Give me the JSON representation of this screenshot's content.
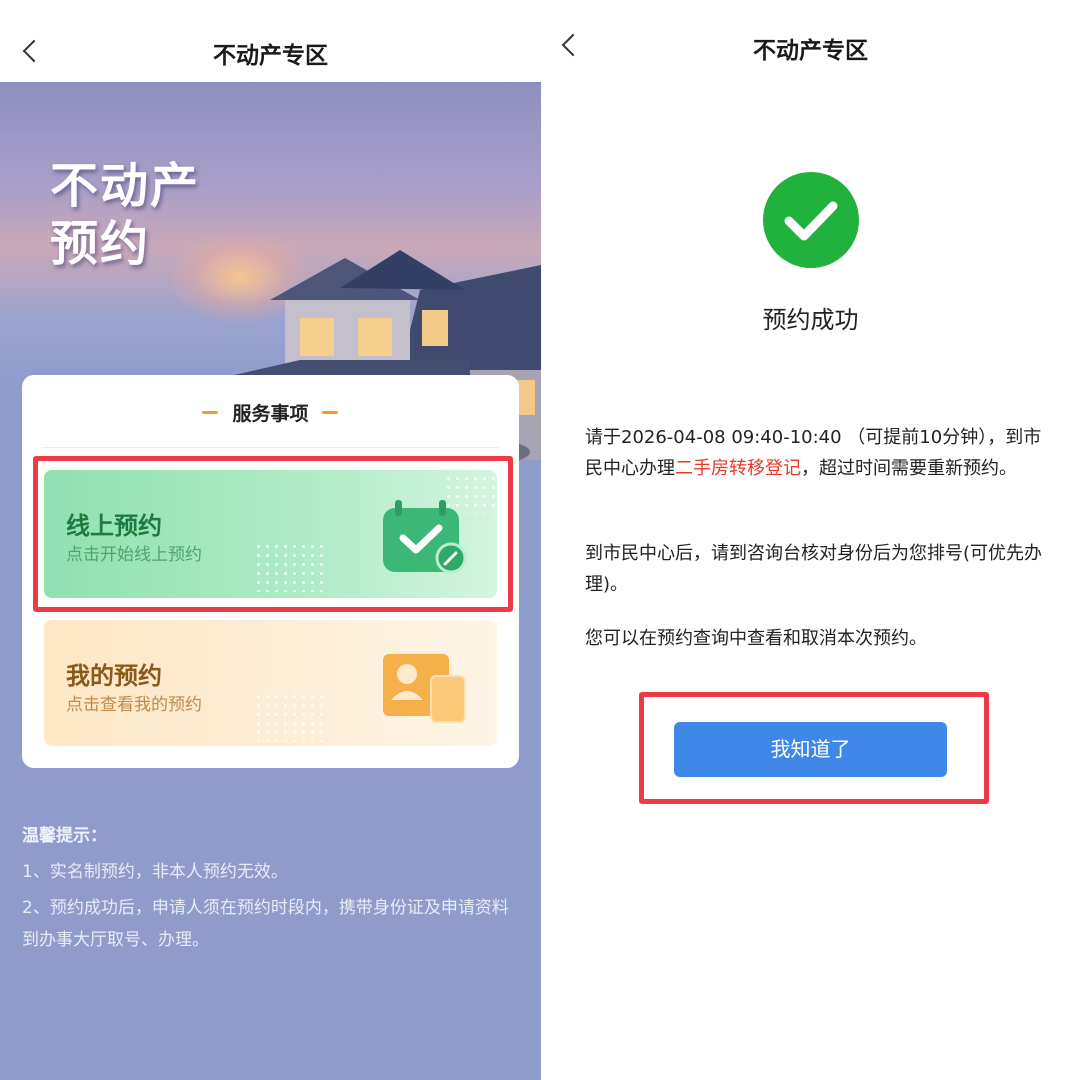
{
  "left_screen": {
    "nav": {
      "title": "不动产专区"
    },
    "banner": {
      "title_line1": "不动产",
      "title_line2": "预约"
    },
    "services": {
      "heading": "服务事项",
      "online": {
        "title": "线上预约",
        "subtitle": "点击开始线上预约"
      },
      "mine": {
        "title": "我的预约",
        "subtitle": "点击查看我的预约"
      }
    },
    "tips": {
      "title": "温馨提示：",
      "items": [
        "1、实名制预约，非本人预约无效。",
        "2、预约成功后，申请人须在预约时段内，携带身份证及申请资料到办事大厅取号、办理。"
      ]
    }
  },
  "right_screen": {
    "nav": {
      "title": "不动产专区"
    },
    "status": "预约成功",
    "message1": {
      "part1": "请于2026-04-08 09:40-10:40 （可提前10分钟），到市民中心办理",
      "highlight": "二手房转移登记",
      "part2": "，超过时间需要重新预约。"
    },
    "message2": "到市民中心后，请到咨询台核对身份后为您排号(可优先办理)。",
    "message3": "您可以在预约查询中查看和取消本次预约。",
    "confirm_button": "我知道了"
  },
  "colors": {
    "left_background": "#8f9ccb",
    "success_green": "#20b23c",
    "button_blue": "#3f87e8",
    "highlight_red": "#ee3a45",
    "accent_orange": "#f39a2c",
    "link_red": "#e8382c"
  }
}
